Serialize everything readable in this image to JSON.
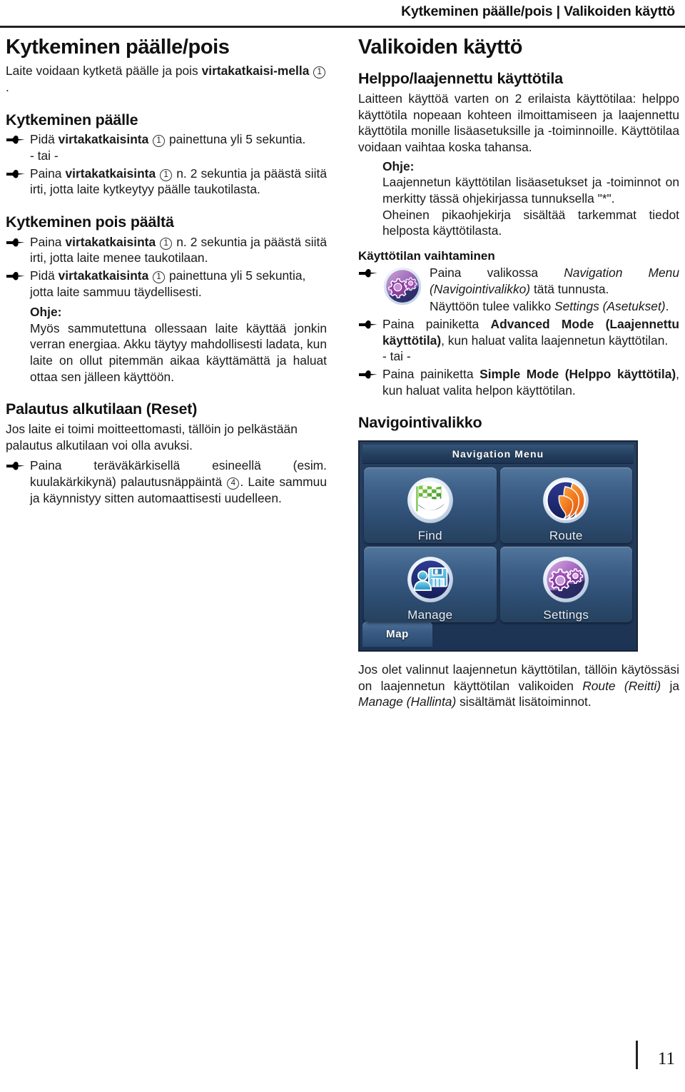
{
  "header": {
    "running_head": "Kytkeminen päälle/pois | Valikoiden käyttö"
  },
  "left_column": {
    "title": "Kytkeminen päälle/pois",
    "intro_a": "Laite voidaan kytketä päälle ja pois ",
    "intro_b": "virtakatkaisi-mella",
    "intro_callout": "1",
    "intro_end": ".",
    "power_on": {
      "heading": "Kytkeminen päälle",
      "item1_a": "Pidä ",
      "item1_b": "virtakatkaisinta",
      "item1_callout": "1",
      "item1_c": " painettuna yli 5 sekuntia.",
      "or_label": "- tai -",
      "item2_a": "Paina ",
      "item2_b": "virtakatkaisinta",
      "item2_callout": "1",
      "item2_c": " n. 2 sekuntia ja päästä siitä irti, jotta laite kytkeytyy päälle taukotilasta."
    },
    "power_off": {
      "heading": "Kytkeminen pois päältä",
      "item1_a": "Paina ",
      "item1_b": "virtakatkaisinta",
      "item1_callout": "1",
      "item1_c": " n. 2 sekuntia ja päästä siitä irti, jotta laite menee taukotilaan.",
      "item2_a": "Pidä ",
      "item2_b": "virtakatkaisinta",
      "item2_callout": "1",
      "item2_c": " painettuna yli 5 sekuntia, jotta laite sammuu täydellisesti.",
      "note_label": "Ohje:",
      "note_text": "Myös sammutettuna ollessaan laite käyttää jonkin verran energiaa. Akku täytyy mahdollisesti ladata, kun laite on ollut pitemmän aikaa käyttämättä ja haluat ottaa sen jälleen käyttöön."
    },
    "reset": {
      "heading": "Palautus alkutilaan (Reset)",
      "intro": "Jos laite ei toimi moitteettomasti, tällöin jo pelkästään palautus alkutilaan voi olla avuksi.",
      "item1_a": "Paina teräväkärkisellä esineellä (esim. kuulakärkikynä) palautusnäppäintä ",
      "item1_callout": "4",
      "item1_b": ". Laite sammuu ja käynnistyy sitten automaattisesti uudelleen."
    }
  },
  "right_column": {
    "title": "Valikoiden käyttö",
    "modes": {
      "heading": "Helppo/laajennettu käyttötila",
      "paragraph": "Laitteen käyttöä varten on 2 erilaista käyttötilaa: helppo käyttötila nopeaan kohteen ilmoittamiseen ja laajennettu käyttötila monille lisäasetuksille ja -toiminnoille. Käyttötilaa voidaan vaihtaa koska tahansa.",
      "note_label": "Ohje:",
      "note_text_1": "Laajennetun käyttötilan lisäasetukset ja -toiminnot on merkitty tässä ohjekirjassa tunnuksella \"*\".",
      "note_text_2": "Oheinen pikaohjekirja sisältää tarkemmat tiedot helposta käyttötilasta."
    },
    "switch_mode": {
      "heading": "Käyttötilan vaihtaminen",
      "item1_a": "Paina valikossa ",
      "item1_em": "Navigation Menu (Navigointivalikko)",
      "item1_b": " tätä tunnusta.",
      "item1_line2_a": "Näyttöön tulee valikko ",
      "item1_line2_em": "Settings (Asetukset)",
      "item1_line2_b": ".",
      "item2_a": "Paina painiketta ",
      "item2_b": "Advanced Mode (Laajennettu käyttötila)",
      "item2_c": ", kun haluat valita laajennetun käyttötilan.",
      "or_label": "- tai -",
      "item3_a": "Paina painiketta ",
      "item3_b": "Simple Mode (Helppo käyttötila)",
      "item3_c": ", kun haluat valita helpon käyttötilan."
    },
    "nav_menu": {
      "heading": "Navigointivalikko",
      "screen_title": "Navigation Menu",
      "tiles": [
        {
          "label": "Find",
          "icon": "checkered-flag-globe-icon"
        },
        {
          "label": "Route",
          "icon": "orange-road-globe-icon"
        },
        {
          "label": "Manage",
          "icon": "person-floppy-globe-icon"
        },
        {
          "label": "Settings",
          "icon": "purple-gears-globe-icon"
        }
      ],
      "map_button": "Map"
    },
    "closing_a": "Jos olet valinnut laajennetun käyttötilan, tällöin käytössäsi on laajennetun käyttötilan valikoiden ",
    "closing_em1": "Route (Reitti)",
    "closing_mid": " ja ",
    "closing_em2": "Manage (Hallinta)",
    "closing_b": " sisältämät lisätoiminnot."
  },
  "footer": {
    "page_number": "11"
  },
  "colors": {
    "screen_bg_dark": "#1d3354",
    "screen_title_bar": "#24405f",
    "tile_blue": "#3d6089",
    "flag_green": "#5aaa33",
    "route_orange": "#ef7722",
    "manage_cyan": "#36a9d6",
    "settings_purple": "#8e3fa0",
    "globe_navy": "#1f2d6b",
    "rule_black": "#222222"
  }
}
